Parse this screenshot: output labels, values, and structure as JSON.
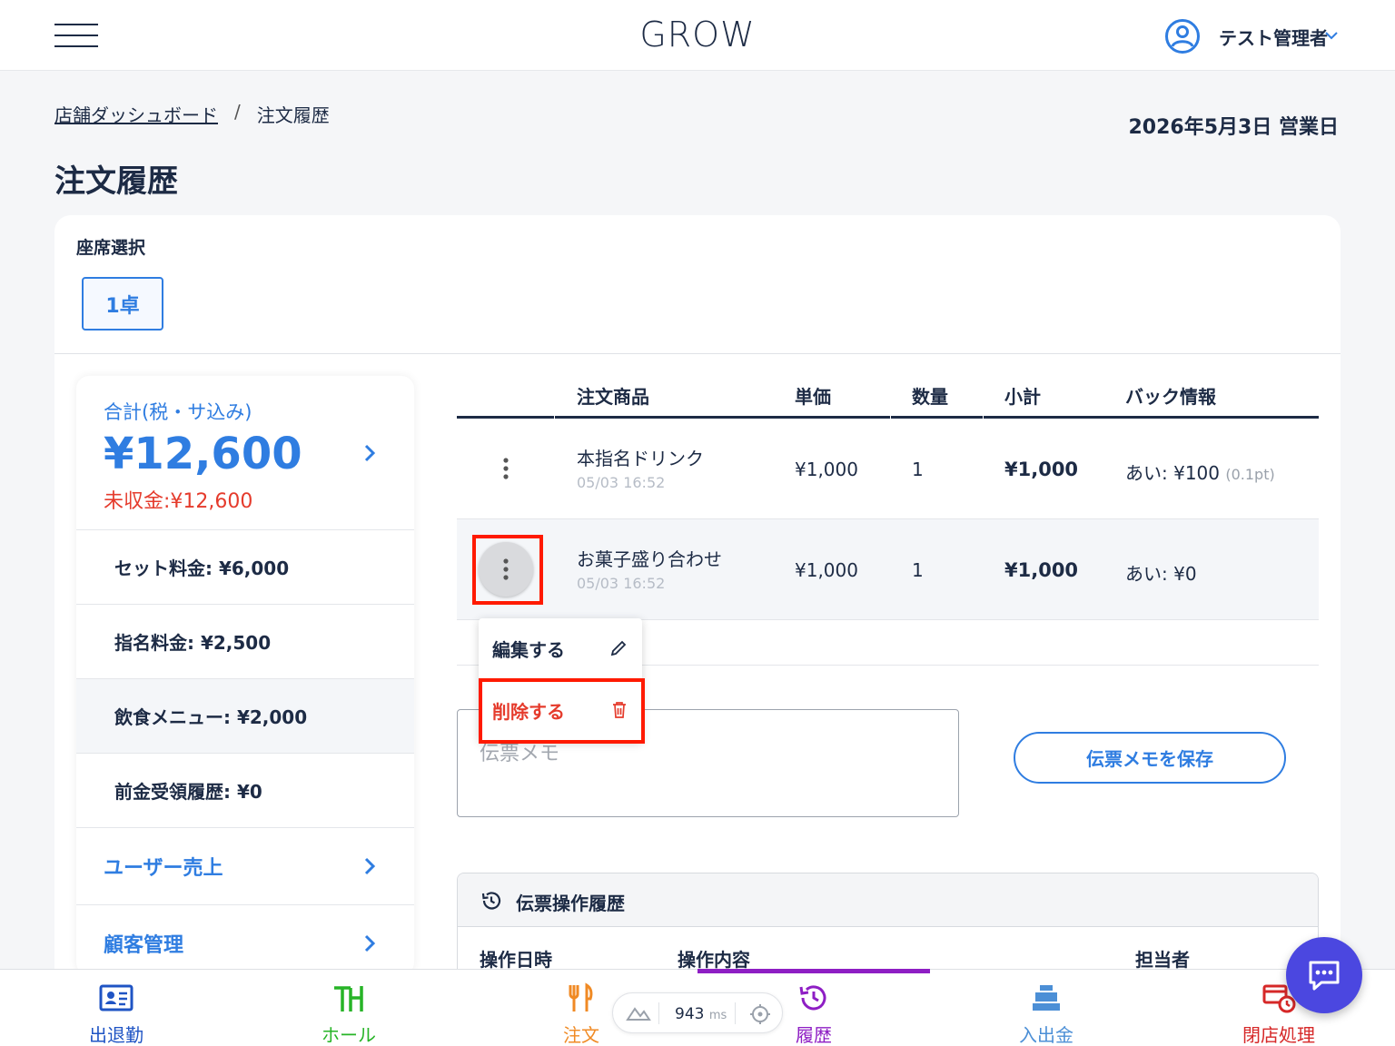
{
  "header": {
    "logo": "GROW",
    "user_name": "テスト管理者"
  },
  "breadcrumb": {
    "home": "店舗ダッシュボード",
    "separator": "/",
    "current": "注文履歴"
  },
  "business_date": "2026年5月3日 営業日",
  "page_title": "注文履歴",
  "seat": {
    "label": "座席選択",
    "selected": "1卓"
  },
  "summary": {
    "total_label": "合計(税・サ込み)",
    "total": "¥12,600",
    "unpaid": "未収金:¥12,600",
    "rows": [
      "セット料金: ¥6,000",
      "指名料金: ¥2,500",
      "飲食メニュー: ¥2,000",
      "前金受領履歴: ¥0"
    ],
    "links": [
      "ユーザー売上",
      "顧客管理"
    ]
  },
  "orders": {
    "headers": {
      "item": "注文商品",
      "price": "単価",
      "qty": "数量",
      "subtotal": "小計",
      "back": "バック情報"
    },
    "rows": [
      {
        "name": "本指名ドリンク",
        "time": "05/03 16:52",
        "price": "¥1,000",
        "qty": "1",
        "subtotal": "¥1,000",
        "back": "あい: ¥100",
        "back_pt": "(0.1pt)"
      },
      {
        "name": "お菓子盛り合わせ",
        "time": "05/03 16:52",
        "price": "¥1,000",
        "qty": "1",
        "subtotal": "¥1,000",
        "back": "あい: ¥0",
        "back_pt": ""
      }
    ]
  },
  "context_menu": {
    "edit": "編集する",
    "delete": "削除する"
  },
  "memo": {
    "placeholder": "伝票メモ",
    "save_label": "伝票メモを保存"
  },
  "ops_history": {
    "title": "伝票操作履歴",
    "columns": [
      "操作日時",
      "操作内容",
      "担当者"
    ]
  },
  "perf": {
    "value": "943",
    "unit": "ms"
  },
  "bottom_nav": [
    {
      "label": "出退勤",
      "color": "#1f54c4"
    },
    {
      "label": "ホール",
      "color": "#27b427"
    },
    {
      "label": "注文",
      "color": "#f08a24"
    },
    {
      "label": "履歴",
      "color": "#8e1ec4"
    },
    {
      "label": "入出金",
      "color": "#4c8fd6"
    },
    {
      "label": "閉店処理",
      "color": "#d62828"
    }
  ],
  "colors": {
    "accent": "#2f7de1",
    "danger": "#e53b2c",
    "text": "#1d2b45",
    "chat": "#4b47e0"
  }
}
